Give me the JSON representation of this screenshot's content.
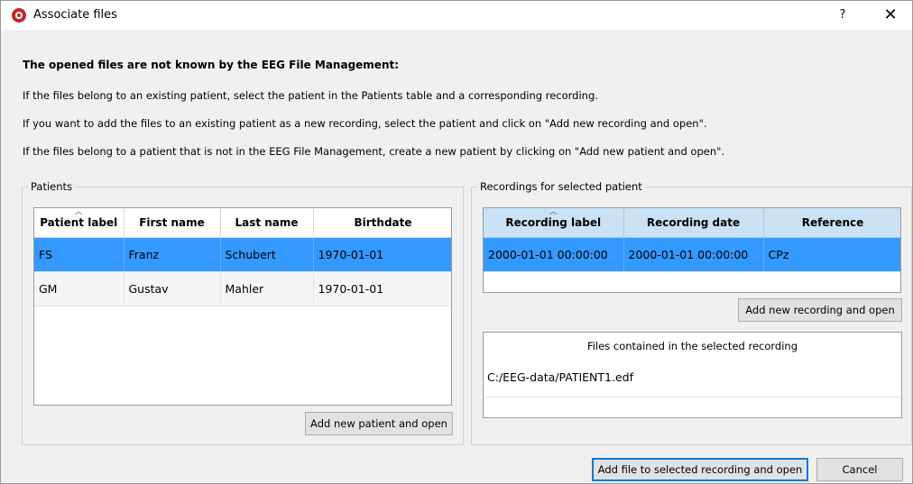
{
  "window": {
    "title": "Associate files",
    "help_label": "?",
    "close_label": "✕"
  },
  "message": {
    "heading": "The opened files are not known by the EEG File Management:",
    "line1": "If the files belong to an existing patient, select the patient in the Patients table and a corresponding recording.",
    "line2": "If you want to add the files to an existing patient as a new recording, select the patient and click on \"Add new recording and open\".",
    "line3": "If the files belong to a patient that is not in the EEG File Management, create a new patient by clicking on \"Add new patient and open\"."
  },
  "patients": {
    "group_title": "Patients",
    "columns": [
      "Patient label",
      "First name",
      "Last name",
      "Birthdate"
    ],
    "rows": [
      {
        "label": "FS",
        "first": "Franz",
        "last": "Schubert",
        "birthdate": "1970-01-01",
        "selected": true
      },
      {
        "label": "GM",
        "first": "Gustav",
        "last": "Mahler",
        "birthdate": "1970-01-01",
        "selected": false
      }
    ],
    "add_button": "Add new patient and open"
  },
  "recordings": {
    "group_title": "Recordings for selected patient",
    "columns": [
      "Recording label",
      "Recording date",
      "Reference"
    ],
    "rows": [
      {
        "label": "2000-01-01 00:00:00",
        "date": "2000-01-01 00:00:00",
        "reference": "CPz",
        "selected": true
      }
    ],
    "add_button": "Add new recording and open",
    "files_header": "Files contained in the selected recording",
    "files": [
      "C:/EEG-data/PATIENT1.edf"
    ]
  },
  "footer": {
    "add_file_button": "Add file to selected recording and open",
    "cancel_button": "Cancel"
  },
  "colors": {
    "selection": "#3399ff",
    "recordings_header": "#c9e2f5",
    "default_button_border": "#0078d7",
    "app_icon": "#c0282d"
  },
  "icons": {
    "app": "app-logo-icon",
    "sort": "sort-ascending-icon"
  }
}
